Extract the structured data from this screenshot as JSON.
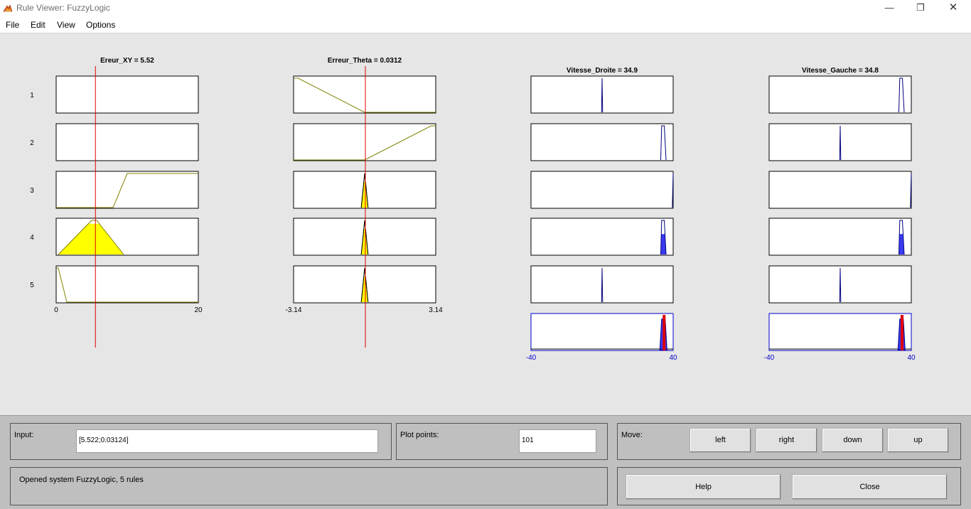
{
  "window": {
    "title": "Rule Viewer: FuzzyLogic",
    "minimize_glyph": "—",
    "restore_glyph": "❐",
    "close_glyph": "✕"
  },
  "menu": [
    "File",
    "Edit",
    "View",
    "Options"
  ],
  "inputs": [
    {
      "title": "Ereur_XY = 5.52",
      "range": [
        0,
        20
      ],
      "tick_labels": [
        "0",
        "20"
      ],
      "value": 5.522
    },
    {
      "title": "Erreur_Theta = 0.0312",
      "range": [
        -3.14,
        3.14
      ],
      "tick_labels": [
        "-3.14",
        "3.14"
      ],
      "value": 0.03124
    }
  ],
  "outputs": [
    {
      "title": "Vitesse_Droite = 34.9",
      "range": [
        -40,
        40
      ],
      "tick_labels": [
        "-40",
        "40"
      ],
      "value": 34.9
    },
    {
      "title": "Vitesse_Gauche = 34.8",
      "range": [
        -40,
        40
      ],
      "tick_labels": [
        "-40",
        "40"
      ],
      "value": 34.8
    }
  ],
  "rule_numbers": [
    "1",
    "2",
    "3",
    "4",
    "5"
  ],
  "colors": {
    "input_line": "#808000",
    "input_fill": "#ffff00",
    "output_line": "#000080",
    "output_fill": "#3a3af0",
    "indicator": "#e00000",
    "output_axis": "#0000cc"
  },
  "input_panel": {
    "label": "Input:",
    "value": "[5.522;0.03124]"
  },
  "plot_points": {
    "label": "Plot points:",
    "value": "101"
  },
  "move": {
    "label": "Move:",
    "buttons": [
      "left",
      "right",
      "down",
      "up"
    ]
  },
  "status": {
    "text": "Opened system FuzzyLogic, 5 rules"
  },
  "actions": {
    "help": "Help",
    "close": "Close"
  }
}
